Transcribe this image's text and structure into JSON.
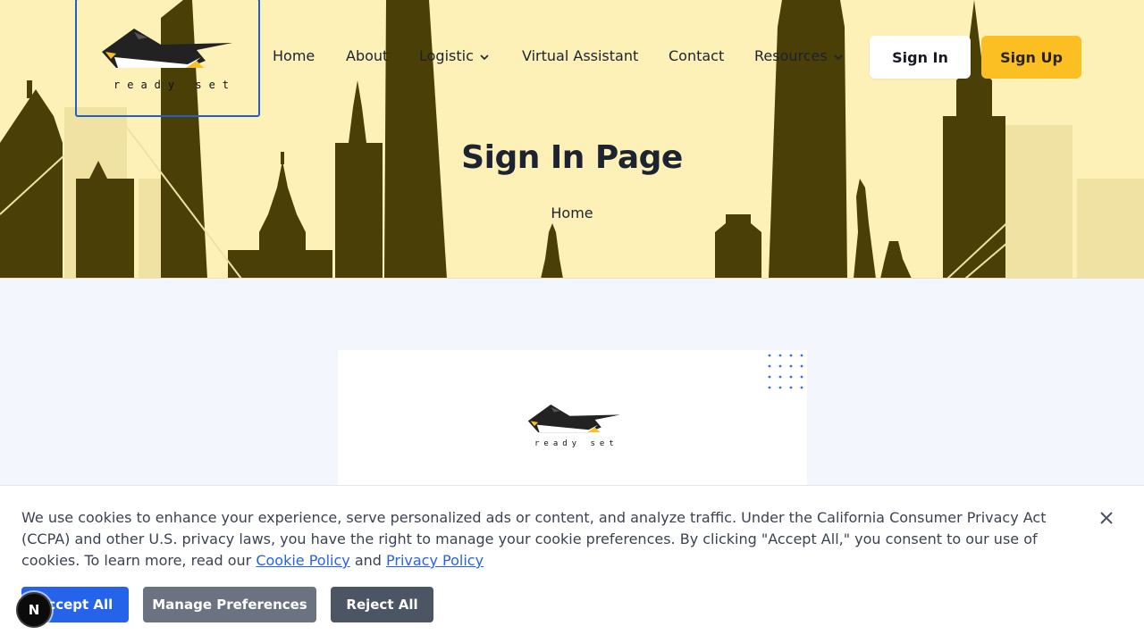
{
  "brand": {
    "logo_text": "ready set",
    "card_logo_text": "ready set"
  },
  "nav": {
    "items": [
      {
        "label": "Home",
        "has_dropdown": false
      },
      {
        "label": "About",
        "has_dropdown": false
      },
      {
        "label": "Logistic",
        "has_dropdown": true
      },
      {
        "label": "Virtual Assistant",
        "has_dropdown": false
      },
      {
        "label": "Contact",
        "has_dropdown": false
      },
      {
        "label": "Resources",
        "has_dropdown": true
      }
    ],
    "sign_in_label": "Sign In",
    "sign_up_label": "Sign Up"
  },
  "hero": {
    "title": "Sign In Page",
    "breadcrumb": "Home"
  },
  "cookie_banner": {
    "text_before": "We use cookies to enhance your experience, serve personalized ads or content, and analyze traffic. Under the California Consumer Privacy Act (CCPA) and other U.S. privacy laws, you have the right to manage your cookie preferences. By clicking \"Accept All,\" you consent to our use of cookies. To learn more, read our ",
    "cookie_policy_link": "Cookie Policy",
    "text_and": " and ",
    "privacy_policy_link": "Privacy Policy",
    "accept_label": "Accept All",
    "manage_label": "Manage Preferences",
    "reject_label": "Reject All"
  },
  "next_badge": "N",
  "colors": {
    "hero_bg": "#fdf1b8",
    "skyline": "#4a3f06",
    "accent_yellow": "#fbbf24",
    "link_blue": "#2563eb",
    "page_bg": "#f3f6fd"
  },
  "icons": {
    "close": "close-icon",
    "chevron": "chevron-down-icon"
  }
}
